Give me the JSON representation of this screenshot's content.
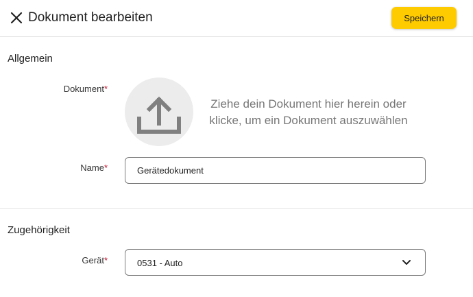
{
  "header": {
    "title": "Dokument bearbeiten",
    "save_label": "Speichern"
  },
  "general": {
    "section_title": "Allgemein",
    "document_label": "Dokument",
    "required_mark": "*",
    "upload_line1": "Ziehe dein Dokument hier herein oder",
    "upload_line2": "klicke, um ein Dokument auszuwählen",
    "name_label": "Name",
    "name_value": "Gerätedokument"
  },
  "association": {
    "section_title": "Zugehörigkeit",
    "device_label": "Gerät",
    "device_value": "0531 - Auto"
  },
  "icons": {
    "close": "close-icon",
    "upload": "upload-icon",
    "chevron": "chevron-down-icon"
  },
  "colors": {
    "accent": "#fecb00",
    "required": "#c8102e",
    "upload_bg": "#ececec",
    "icon_gray": "#808080"
  }
}
